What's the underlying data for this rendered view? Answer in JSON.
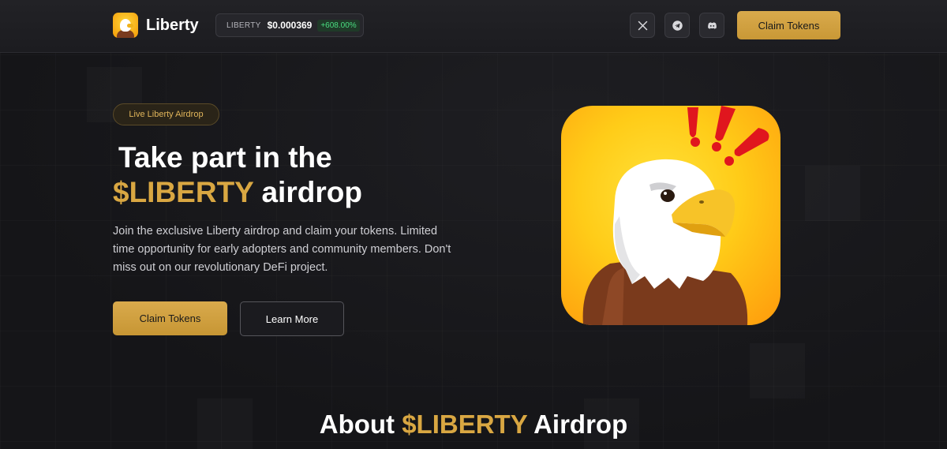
{
  "header": {
    "logo_text": "Liberty",
    "ticker": {
      "symbol": "LIBERTY",
      "price": "$0.000369",
      "change": "+608.00%"
    },
    "social": [
      {
        "name": "x",
        "icon": "x-icon"
      },
      {
        "name": "telegram",
        "icon": "telegram-icon"
      },
      {
        "name": "discord",
        "icon": "discord-icon"
      }
    ],
    "cta_label": "Claim Tokens"
  },
  "hero": {
    "badge": "Live Liberty Airdrop",
    "title_line1": "Take part in the",
    "title_highlight": "$LIBERTY",
    "title_rest": "airdrop",
    "description": "Join the exclusive Liberty airdrop and claim your tokens. Limited time opportunity for early adopters and community members. Don't miss out on our revolutionary DeFi project.",
    "primary_button": "Claim Tokens",
    "secondary_button": "Learn More"
  },
  "about": {
    "title_prefix": "About",
    "title_highlight": "$LIBERTY",
    "title_suffix": "Airdrop"
  },
  "colors": {
    "background": "#16161a",
    "accent_gold": "#d9a742",
    "positive_green": "#4ade80"
  }
}
